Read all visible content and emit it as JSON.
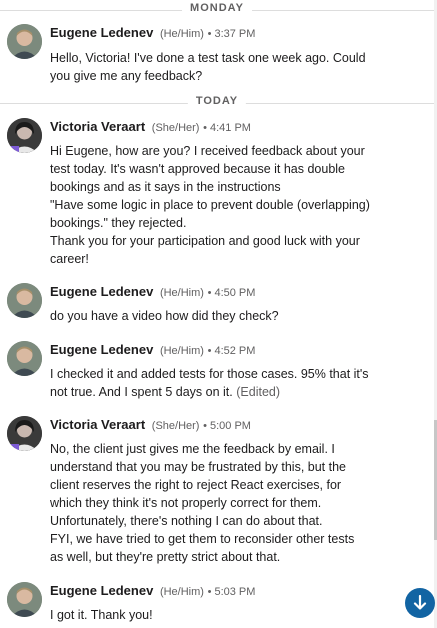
{
  "dividers": {
    "monday": "MONDAY",
    "today": "TODAY"
  },
  "messages": [
    {
      "author": "Eugene Ledenev",
      "pronouns": "(He/Him)",
      "time": "• 3:37 PM",
      "lines": [
        "Hello, Victoria! I've done a test task one week ago. Could",
        "you give me any feedback?"
      ]
    },
    {
      "author": "Victoria Veraart",
      "pronouns": "(She/Her)",
      "time": "• 4:41 PM",
      "lines": [
        "Hi Eugene, how are you? I received feedback about your",
        "test today. It's wasn't approved because it has double",
        "bookings and as it says in the instructions",
        "\"Have some logic in place to prevent double (overlapping)",
        "bookings.\" they rejected.",
        "Thank you for your participation and good luck with your",
        "career!"
      ]
    },
    {
      "author": "Eugene Ledenev",
      "pronouns": "(He/Him)",
      "time": "• 4:50 PM",
      "lines": [
        "do you have a video how did they check?"
      ]
    },
    {
      "author": "Eugene Ledenev",
      "pronouns": "(He/Him)",
      "time": "• 4:52 PM",
      "lines": [
        "I checked it and added tests for those cases. 95% that it's",
        "not true. And I spent 5 days on it."
      ],
      "edited": "(Edited)"
    },
    {
      "author": "Victoria Veraart",
      "pronouns": "(She/Her)",
      "time": "• 5:00 PM",
      "lines": [
        "No, the client just gives me the feedback by email. I",
        "understand that you may be frustrated by this, but the",
        "client reserves the right to reject React exercises, for",
        "which they think it's not properly correct for them.",
        "Unfortunately, there's nothing I can do about that.",
        "FYI, we have tried to get them to reconsider other tests",
        "as well, but they're pretty strict about that."
      ]
    },
    {
      "author": "Eugene Ledenev",
      "pronouns": "(He/Him)",
      "time": "• 5:03 PM",
      "lines": [
        "I got it. Thank you!"
      ]
    }
  ],
  "colors": {
    "accent": "#1264a3",
    "muted": "#616061",
    "text": "#1d1c1d"
  },
  "icons": {
    "jump": "arrow-down-icon"
  }
}
